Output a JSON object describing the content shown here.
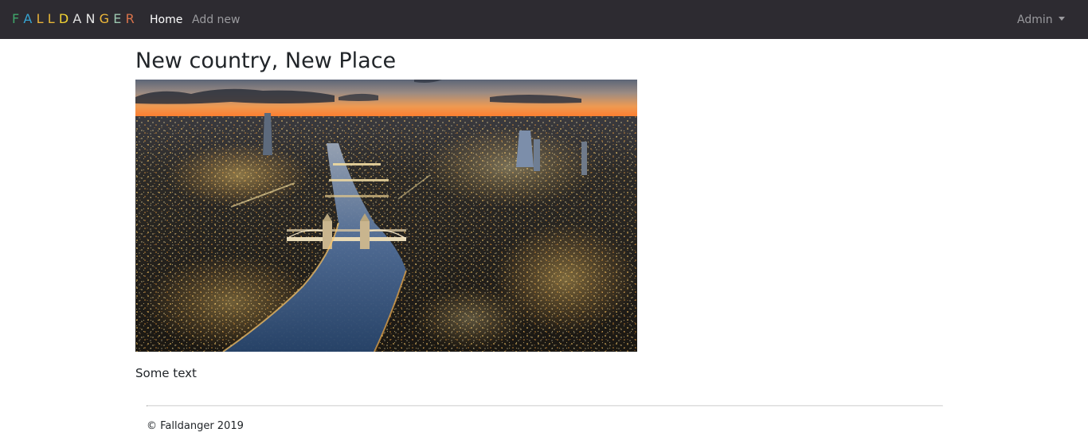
{
  "navbar": {
    "brand": {
      "letters": [
        "F",
        "A",
        "L",
        "L",
        "D",
        "A",
        "N",
        "G",
        "E",
        "R"
      ],
      "colors": [
        "#3fa66a",
        "#36a3d1",
        "#e8b13b",
        "#e6b637",
        "#f2d433",
        "#e0e0e0",
        "#e5e5e5",
        "#f0b93a",
        "#9cc7b0",
        "#d9734b"
      ]
    },
    "links": {
      "home": "Home",
      "add_new": "Add new"
    },
    "user_menu": "Admin"
  },
  "main": {
    "title": "New country, New Place",
    "image_subject": "London aerial night view of river and bridges",
    "text": "Some text"
  },
  "footer": {
    "copyright": "© Falldanger 2019"
  },
  "colors": {
    "navbar_bg": "#2d2b31",
    "nav_active": "#ffffff",
    "nav_muted": "#9a9a9e"
  }
}
